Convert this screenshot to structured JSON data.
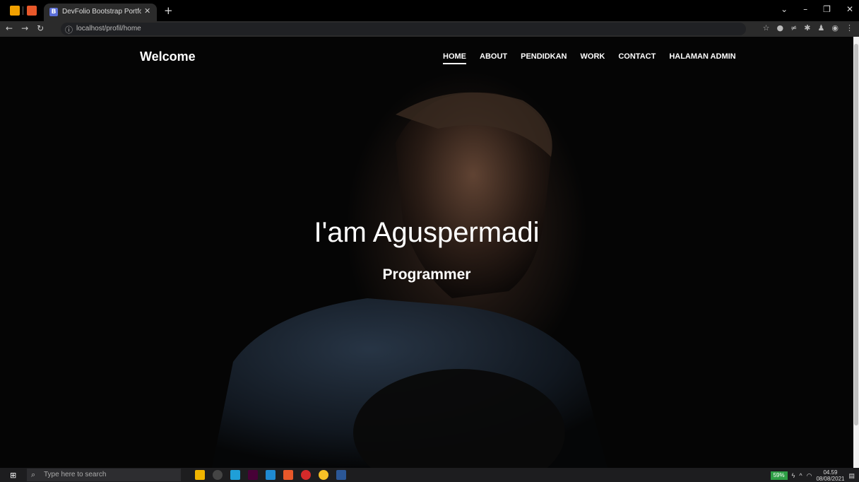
{
  "browser": {
    "tab_title": "DevFolio Bootstrap Portfolio Tem",
    "tab_favicon": "B",
    "url": "localhost/profil/home"
  },
  "site": {
    "brand": "Welcome",
    "nav": [
      "HOME",
      "ABOUT",
      "PENDIDKAN",
      "WORK",
      "CONTACT",
      "HALAMAN ADMIN"
    ],
    "active_nav": "HOME",
    "hero_title": "I'am Aguspermadi",
    "hero_subtitle": "Programmer"
  },
  "taskbar": {
    "search_placeholder": "Type here to search",
    "battery": "59%",
    "time": "04.59",
    "date": "08/08/2021"
  },
  "colors": {
    "background": "#000000",
    "text": "#ffffff"
  }
}
